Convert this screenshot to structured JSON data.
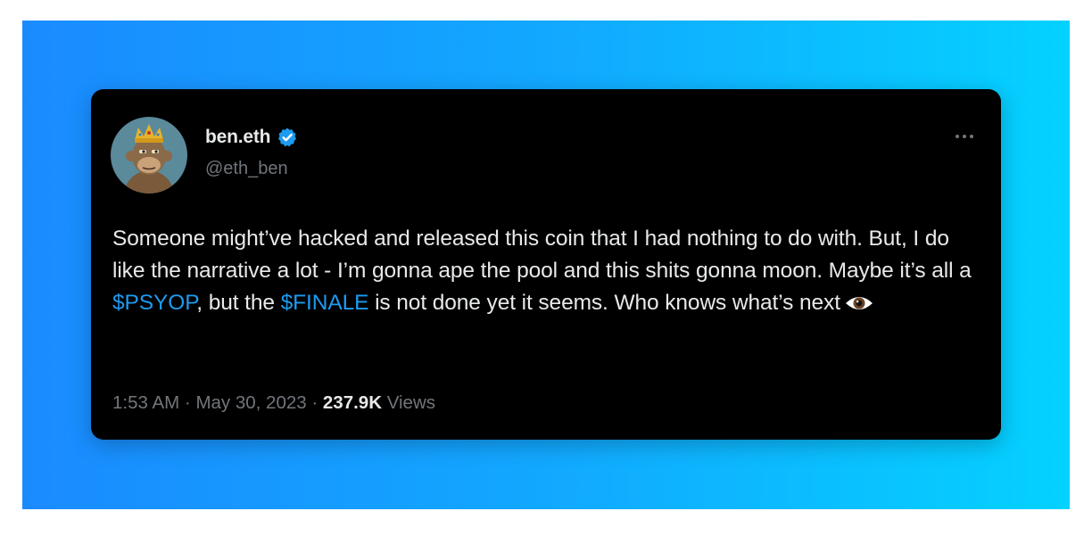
{
  "tweet": {
    "author": {
      "display_name": "ben.eth",
      "handle": "@eth_ben",
      "verified_icon": "verified-badge-icon",
      "avatar": "bored-ape-avatar"
    },
    "more_icon": "more-options-icon",
    "text": {
      "part1": "Someone might’ve hacked and released this coin that I had nothing to do with. But, I do like the narrative a lot - I’m gonna ape the pool and this shits gonna moon. Maybe it’s all a ",
      "cashtag1": "$PSYOP",
      "part2": ", but the ",
      "cashtag2": "$FINALE",
      "part3": " is not done yet it seems. Who knows what’s next",
      "emoji": "eye-emoji-icon"
    },
    "meta": {
      "time": "1:53 AM",
      "sep1": " · ",
      "date": "May 30, 2023",
      "sep2": " · ",
      "views_count": "237.9K",
      "views_label": " Views"
    }
  },
  "colors": {
    "background_gradient_start": "#1a8bff",
    "background_gradient_end": "#04d2ff",
    "card": "#000000",
    "text": "#e7e9ea",
    "muted": "#71767b",
    "link": "#1d9bf0"
  }
}
